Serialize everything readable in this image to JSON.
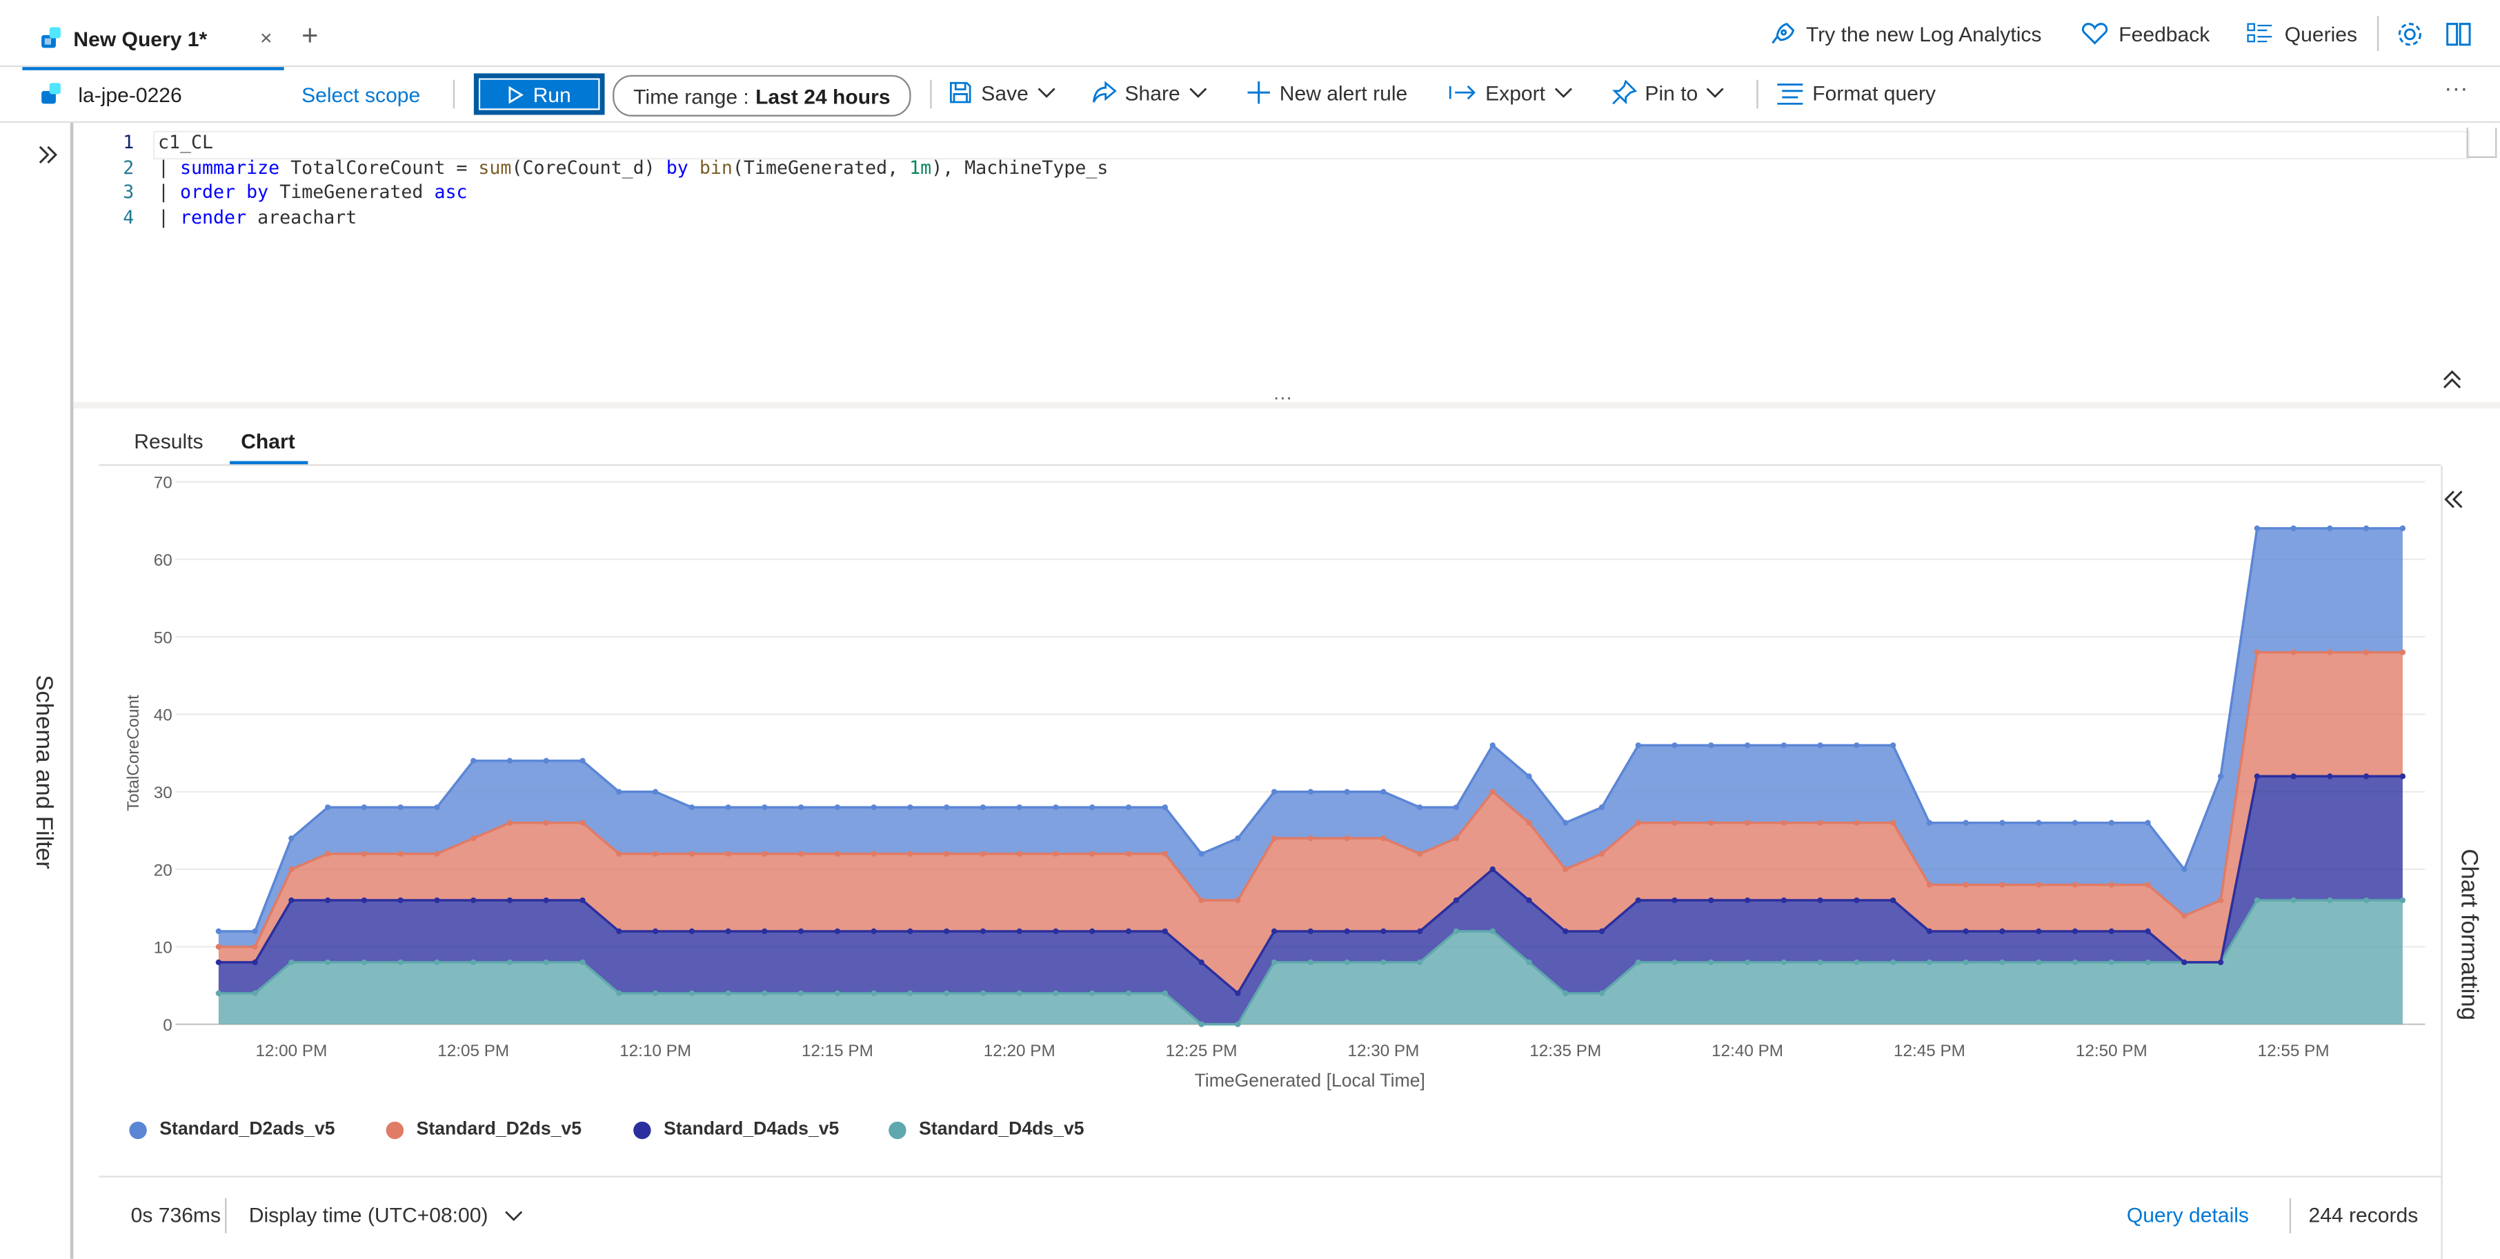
{
  "tab": {
    "title": "New Query 1*",
    "close": "×",
    "add": "+"
  },
  "top_actions": {
    "try_new": "Try the new Log Analytics",
    "feedback": "Feedback",
    "queries": "Queries"
  },
  "workspace": {
    "name": "la-jpe-0226",
    "select_scope": "Select scope"
  },
  "toolbar": {
    "run": "Run",
    "time_range_label": "Time range :",
    "time_range_value": "Last 24 hours",
    "save": "Save",
    "share": "Share",
    "new_alert_rule": "New alert rule",
    "export": "Export",
    "pin_to": "Pin to",
    "format_query": "Format query",
    "more": "···"
  },
  "editor": {
    "line_numbers": [
      "1",
      "2",
      "3",
      "4"
    ],
    "lines": [
      "c1_CL",
      "| summarize TotalCoreCount = sum(CoreCount_d) by bin(TimeGenerated, 1m), MachineType_s",
      "| order by TimeGenerated asc",
      "| render areachart"
    ]
  },
  "splitter": "···",
  "result_tabs": [
    "Results",
    "Chart"
  ],
  "active_result_tab": "Chart",
  "side_panels": {
    "left": "Schema and Filter",
    "right": "Chart formatting"
  },
  "chart_data": {
    "type": "area",
    "stacked": true,
    "xlabel": "TimeGenerated [Local Time]",
    "ylabel": "TotalCoreCount",
    "ylim": [
      0,
      70
    ],
    "yticks": [
      0,
      10,
      20,
      30,
      40,
      50,
      60,
      70
    ],
    "x_tick_labels": [
      "12:00 PM",
      "12:05 PM",
      "12:10 PM",
      "12:15 PM",
      "12:20 PM",
      "12:25 PM",
      "12:30 PM",
      "12:35 PM",
      "12:40 PM",
      "12:45 PM",
      "12:50 PM",
      "12:55 PM"
    ],
    "x_tick_minutes": [
      60,
      65,
      70,
      75,
      80,
      85,
      90,
      95,
      100,
      105,
      110,
      115
    ],
    "x_minutes": [
      58,
      59,
      60,
      61,
      62,
      63,
      64,
      65,
      66,
      67,
      68,
      69,
      70,
      71,
      72,
      73,
      74,
      75,
      76,
      77,
      78,
      79,
      80,
      81,
      82,
      83,
      84,
      85,
      86,
      87,
      88,
      89,
      90,
      91,
      92,
      93,
      94,
      95,
      96,
      97,
      98,
      99,
      100,
      101,
      102,
      103,
      104,
      105,
      106,
      107,
      108,
      109,
      110,
      111,
      112,
      113,
      114,
      115,
      116,
      117,
      118
    ],
    "grid": true,
    "legend_position": "bottom-left",
    "series": [
      {
        "name": "Standard_D4ds_v5",
        "color": "#5fa8ad",
        "values": [
          4,
          4,
          8,
          8,
          8,
          8,
          8,
          8,
          8,
          8,
          8,
          4,
          4,
          4,
          4,
          4,
          4,
          4,
          4,
          4,
          4,
          4,
          4,
          4,
          4,
          4,
          4,
          0,
          0,
          8,
          8,
          8,
          8,
          8,
          12,
          12,
          8,
          4,
          4,
          8,
          8,
          8,
          8,
          8,
          8,
          8,
          8,
          8,
          8,
          8,
          8,
          8,
          8,
          8,
          8,
          8,
          16,
          16,
          16,
          16,
          16
        ]
      },
      {
        "name": "Standard_D4ads_v5",
        "color": "#2b2f9e",
        "values": [
          4,
          4,
          8,
          8,
          8,
          8,
          8,
          8,
          8,
          8,
          8,
          8,
          8,
          8,
          8,
          8,
          8,
          8,
          8,
          8,
          8,
          8,
          8,
          8,
          8,
          8,
          8,
          8,
          4,
          4,
          4,
          4,
          4,
          4,
          4,
          8,
          8,
          8,
          8,
          8,
          8,
          8,
          8,
          8,
          8,
          8,
          8,
          4,
          4,
          4,
          4,
          4,
          4,
          4,
          0,
          0,
          16,
          16,
          16,
          16,
          16
        ]
      },
      {
        "name": "Standard_D2ds_v5",
        "color": "#e07b66",
        "values": [
          2,
          2,
          4,
          6,
          6,
          6,
          6,
          8,
          10,
          10,
          10,
          10,
          10,
          10,
          10,
          10,
          10,
          10,
          10,
          10,
          10,
          10,
          10,
          10,
          10,
          10,
          10,
          8,
          12,
          12,
          12,
          12,
          12,
          10,
          8,
          10,
          10,
          8,
          10,
          10,
          10,
          10,
          10,
          10,
          10,
          10,
          10,
          6,
          6,
          6,
          6,
          6,
          6,
          6,
          6,
          8,
          16,
          16,
          16,
          16,
          16
        ]
      },
      {
        "name": "Standard_D2ads_v5",
        "color": "#5b86d6",
        "values": [
          2,
          2,
          4,
          6,
          6,
          6,
          6,
          10,
          8,
          8,
          8,
          8,
          8,
          6,
          6,
          6,
          6,
          6,
          6,
          6,
          6,
          6,
          6,
          6,
          6,
          6,
          6,
          6,
          8,
          6,
          6,
          6,
          6,
          6,
          4,
          6,
          6,
          6,
          6,
          10,
          10,
          10,
          10,
          10,
          10,
          10,
          10,
          8,
          8,
          8,
          8,
          8,
          8,
          8,
          6,
          16,
          16,
          16,
          16,
          16,
          16
        ]
      }
    ]
  },
  "footer": {
    "duration": "0s 736ms",
    "display_time": "Display time (UTC+08:00)",
    "query_details": "Query details",
    "records": "244 records"
  }
}
